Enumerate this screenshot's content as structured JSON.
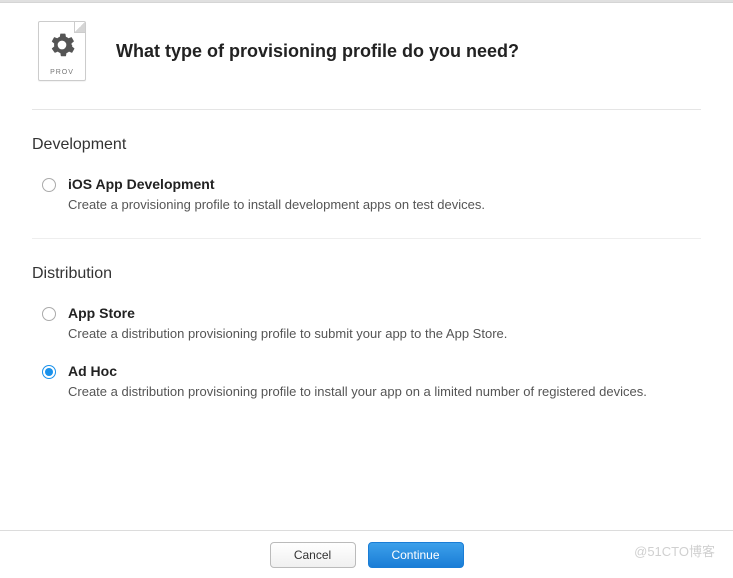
{
  "icon_label": "PROV",
  "title": "What type of provisioning profile do you need?",
  "sections": {
    "development": {
      "heading": "Development",
      "options": [
        {
          "name": "ios-app-development",
          "title": "iOS App Development",
          "desc": "Create a provisioning profile to install development apps on test devices.",
          "selected": false
        }
      ]
    },
    "distribution": {
      "heading": "Distribution",
      "options": [
        {
          "name": "app-store",
          "title": "App Store",
          "desc": "Create a distribution provisioning profile to submit your app to the App Store.",
          "selected": false
        },
        {
          "name": "ad-hoc",
          "title": "Ad Hoc",
          "desc": "Create a distribution provisioning profile to install your app on a limited number of registered devices.",
          "selected": true
        }
      ]
    }
  },
  "buttons": {
    "cancel": "Cancel",
    "continue": "Continue"
  },
  "watermark": "@51CTO博客"
}
